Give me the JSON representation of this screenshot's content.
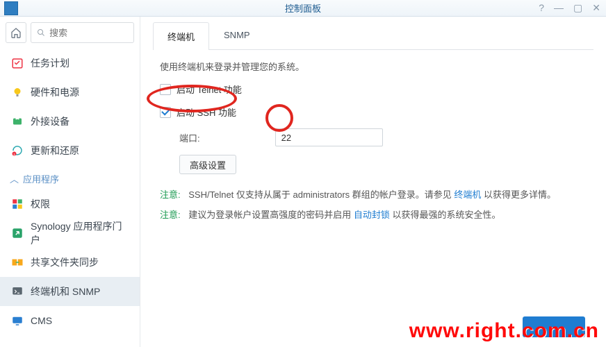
{
  "titlebar": {
    "title": "控制面板"
  },
  "search": {
    "placeholder": "搜索"
  },
  "sidebar": {
    "items": [
      {
        "label": "任务计划"
      },
      {
        "label": "硬件和电源"
      },
      {
        "label": "外接设备"
      },
      {
        "label": "更新和还原"
      }
    ],
    "section": "应用程序",
    "app_items": [
      {
        "label": "权限"
      },
      {
        "label": "Synology 应用程序门户"
      },
      {
        "label": "共享文件夹同步"
      },
      {
        "label": "终端机和 SNMP"
      },
      {
        "label": "CMS"
      }
    ]
  },
  "tabs": {
    "terminal": "终端机",
    "snmp": "SNMP"
  },
  "panel": {
    "desc": "使用终端机来登录并管理您的系统。",
    "enable_telnet": "启动 Telnet 功能",
    "enable_ssh": "启动 SSH 功能",
    "port_label": "端口:",
    "port_value": "22",
    "advanced": "高级设置",
    "notice_tag": "注意:",
    "notice1_a": "SSH/Telnet 仅支持从属于 administrators 群组的帐户登录。请参见 ",
    "notice1_link": "终端机",
    "notice1_b": " 以获得更多详情。",
    "notice2_a": "建议为登录帐户设置高强度的密码并启用 ",
    "notice2_link": "自动封锁",
    "notice2_b": " 以获得最强的系统安全性。"
  },
  "watermark": "www.right.com.cn"
}
